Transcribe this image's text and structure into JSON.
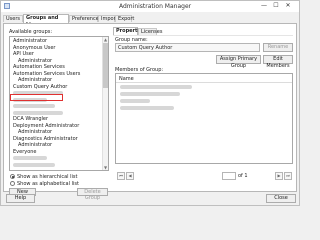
{
  "window": {
    "title": "Administration Manager"
  },
  "tabs": [
    {
      "label": "Users"
    },
    {
      "label": "Groups and Licenses"
    },
    {
      "label": "Preferences"
    },
    {
      "label": "Import"
    },
    {
      "label": "Export"
    }
  ],
  "groups_panel": {
    "label": "Available groups:",
    "items": [
      {
        "label": "Administrator",
        "indent": false
      },
      {
        "label": "Anonymous User",
        "indent": false
      },
      {
        "label": "API User",
        "indent": false
      },
      {
        "label": "Administrator",
        "indent": true
      },
      {
        "label": "Automation Services",
        "indent": false
      },
      {
        "label": "Automation Services Users",
        "indent": false
      },
      {
        "label": "Administrator",
        "indent": true
      },
      {
        "label": "Custom Query Author",
        "indent": false,
        "selected": true
      },
      {
        "label": "",
        "indent": false
      },
      {
        "label": "",
        "indent": false
      },
      {
        "label": "",
        "indent": false
      },
      {
        "label": "",
        "indent": false
      },
      {
        "label": "DCA Wrangler",
        "indent": false
      },
      {
        "label": "Deployment Administrator",
        "indent": false
      },
      {
        "label": "Administrator",
        "indent": true
      },
      {
        "label": "Diagnostics Administrator",
        "indent": false
      },
      {
        "label": "Administrator",
        "indent": true
      },
      {
        "label": "Everyone",
        "indent": false
      },
      {
        "label": "",
        "indent": false
      },
      {
        "label": "",
        "indent": false
      }
    ],
    "view_options": [
      {
        "label": "Show as hierarchical list",
        "selected": true
      },
      {
        "label": "Show as alphabetical list",
        "selected": false
      }
    ],
    "new_group_label": "New Group",
    "delete_group_label": "Delete Group"
  },
  "details_panel": {
    "subtabs": [
      {
        "label": "Properties"
      },
      {
        "label": "Licenses"
      }
    ],
    "group_name_label": "Group name:",
    "group_name_value": "Custom Query Author",
    "rename_label": "Rename",
    "assign_label": "Assign Primary Group",
    "edit_members_label": "Edit Members",
    "members_label": "Members of Group:",
    "members_header": "Name",
    "page_of_label": "of 1"
  },
  "footer": {
    "help_label": "Help",
    "close_label": "Close"
  }
}
